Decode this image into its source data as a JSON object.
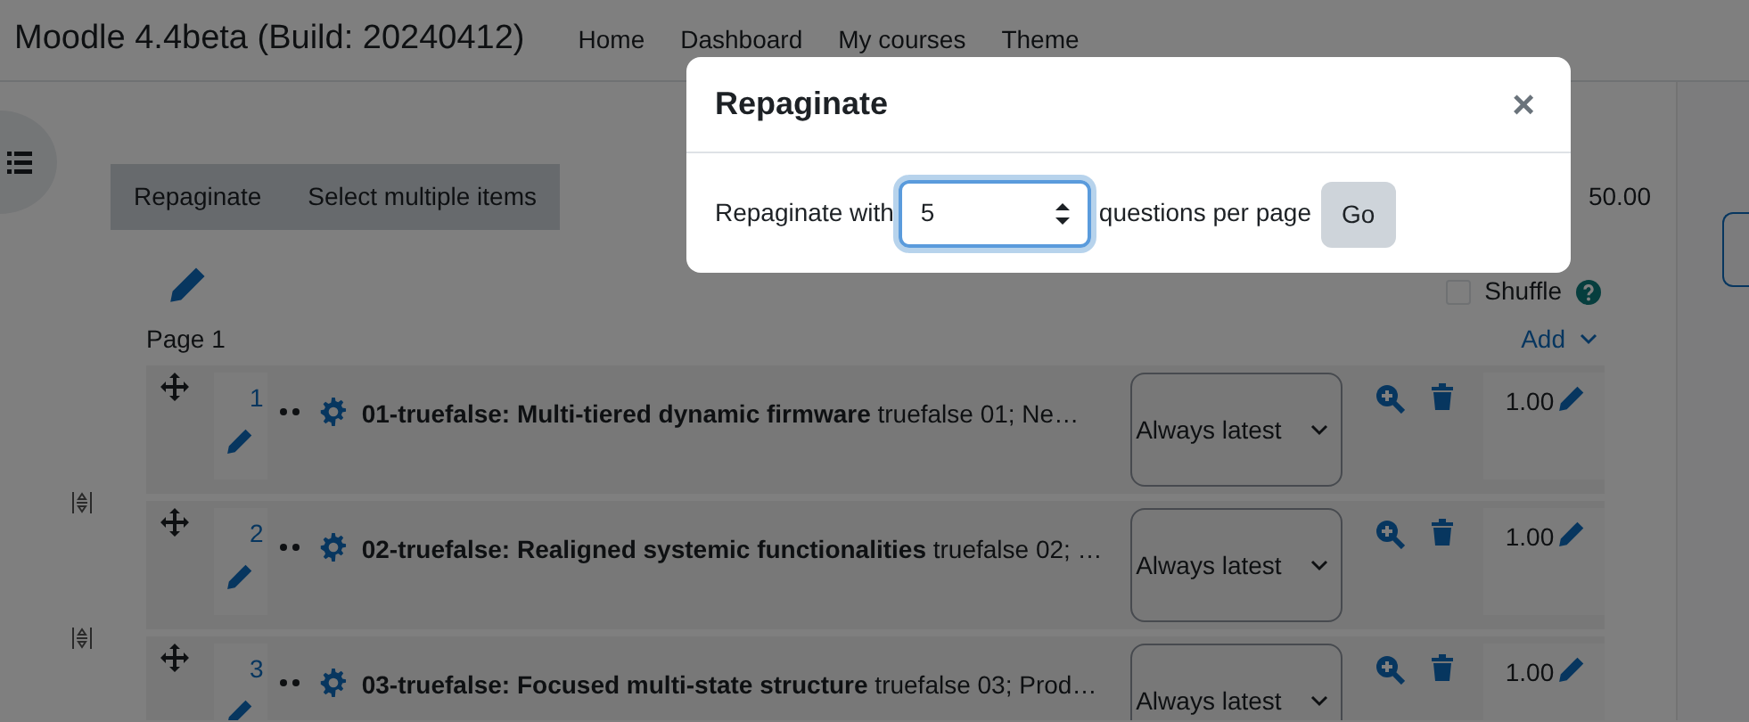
{
  "navbar": {
    "brand": "Moodle 4.4beta (Build: 20240412)",
    "links": [
      {
        "label": "Home"
      },
      {
        "label": "Dashboard"
      },
      {
        "label": "My courses"
      },
      {
        "label": "Theme"
      }
    ]
  },
  "toolbar": {
    "buttons": [
      "Repaginate",
      "Select multiple items"
    ],
    "total": "50.00"
  },
  "shuffle": {
    "label": "Shuffle",
    "checked": false
  },
  "page": {
    "title": "Page 1",
    "add": "Add"
  },
  "slots": [
    {
      "number": "1",
      "title": "01-truefalse: Multi-tiered dynamic firmware",
      "summary": "truefalse 01; Ne…",
      "version": "Always latest",
      "mark": "1.00"
    },
    {
      "number": "2",
      "title": "02-truefalse: Realigned systemic functionalities",
      "summary": "truefalse 02; …",
      "version": "Always latest",
      "mark": "1.00"
    },
    {
      "number": "3",
      "title": "03-truefalse: Focused multi-state structure",
      "summary": "truefalse 03; Prod…",
      "version": "Always latest",
      "mark": "1.00"
    }
  ],
  "modal": {
    "title": "Repaginate",
    "close": "×",
    "label": "Repaginate with",
    "value": "5",
    "suffix": "questions per page",
    "button": "Go"
  }
}
